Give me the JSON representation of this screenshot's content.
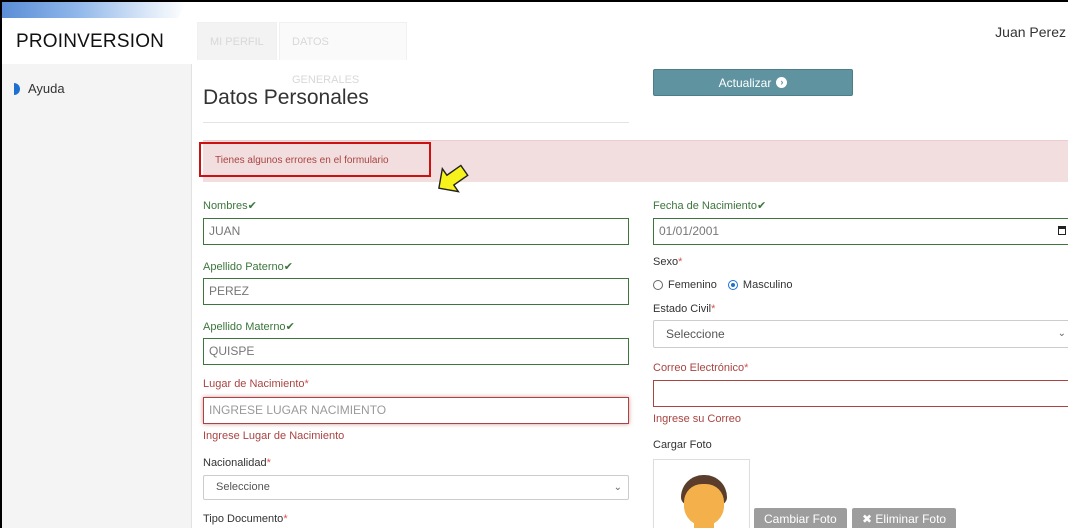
{
  "app": {
    "brand": "PROINVERSION",
    "user_name": "Juan Perez"
  },
  "tabs": [
    {
      "label": "MI PERFIL"
    },
    {
      "label": "DATOS GENERALES"
    }
  ],
  "sidebar": {
    "items": [
      {
        "label": "Ayuda"
      }
    ]
  },
  "page": {
    "title": "Datos Personales",
    "update_button": "Actualizar",
    "alert": "Tienes algunos errores en el formulario"
  },
  "form": {
    "nombres": {
      "label": "Nombres",
      "value": "JUAN"
    },
    "apellido_paterno": {
      "label": "Apellido Paterno",
      "value": "PEREZ"
    },
    "apellido_materno": {
      "label": "Apellido Materno",
      "value": "QUISPE"
    },
    "lugar_nacimiento": {
      "label": "Lugar de Nacimiento",
      "placeholder": "INGRESE LUGAR NACIMIENTO",
      "help": "Ingrese Lugar de Nacimiento"
    },
    "nacionalidad": {
      "label": "Nacionalidad",
      "value": "Seleccione"
    },
    "tipo_documento": {
      "label": "Tipo Documento"
    },
    "fecha_nacimiento": {
      "label": "Fecha de Nacimiento",
      "value": "01/01/2001"
    },
    "sexo": {
      "label": "Sexo",
      "options": [
        "Femenino",
        "Masculino"
      ],
      "selected": "Masculino"
    },
    "estado_civil": {
      "label": "Estado Civil",
      "value": "Seleccione"
    },
    "correo": {
      "label": "Correo Electrónico",
      "value": "",
      "help": "Ingrese su Correo"
    },
    "foto": {
      "label": "Cargar Foto",
      "change_button": "Cambiar Foto",
      "delete_button": "Eliminar Foto"
    }
  },
  "colors": {
    "success": "#3c763d",
    "error": "#a94442",
    "primary_button": "#5f93a0",
    "alert_bg": "#f2dede"
  }
}
